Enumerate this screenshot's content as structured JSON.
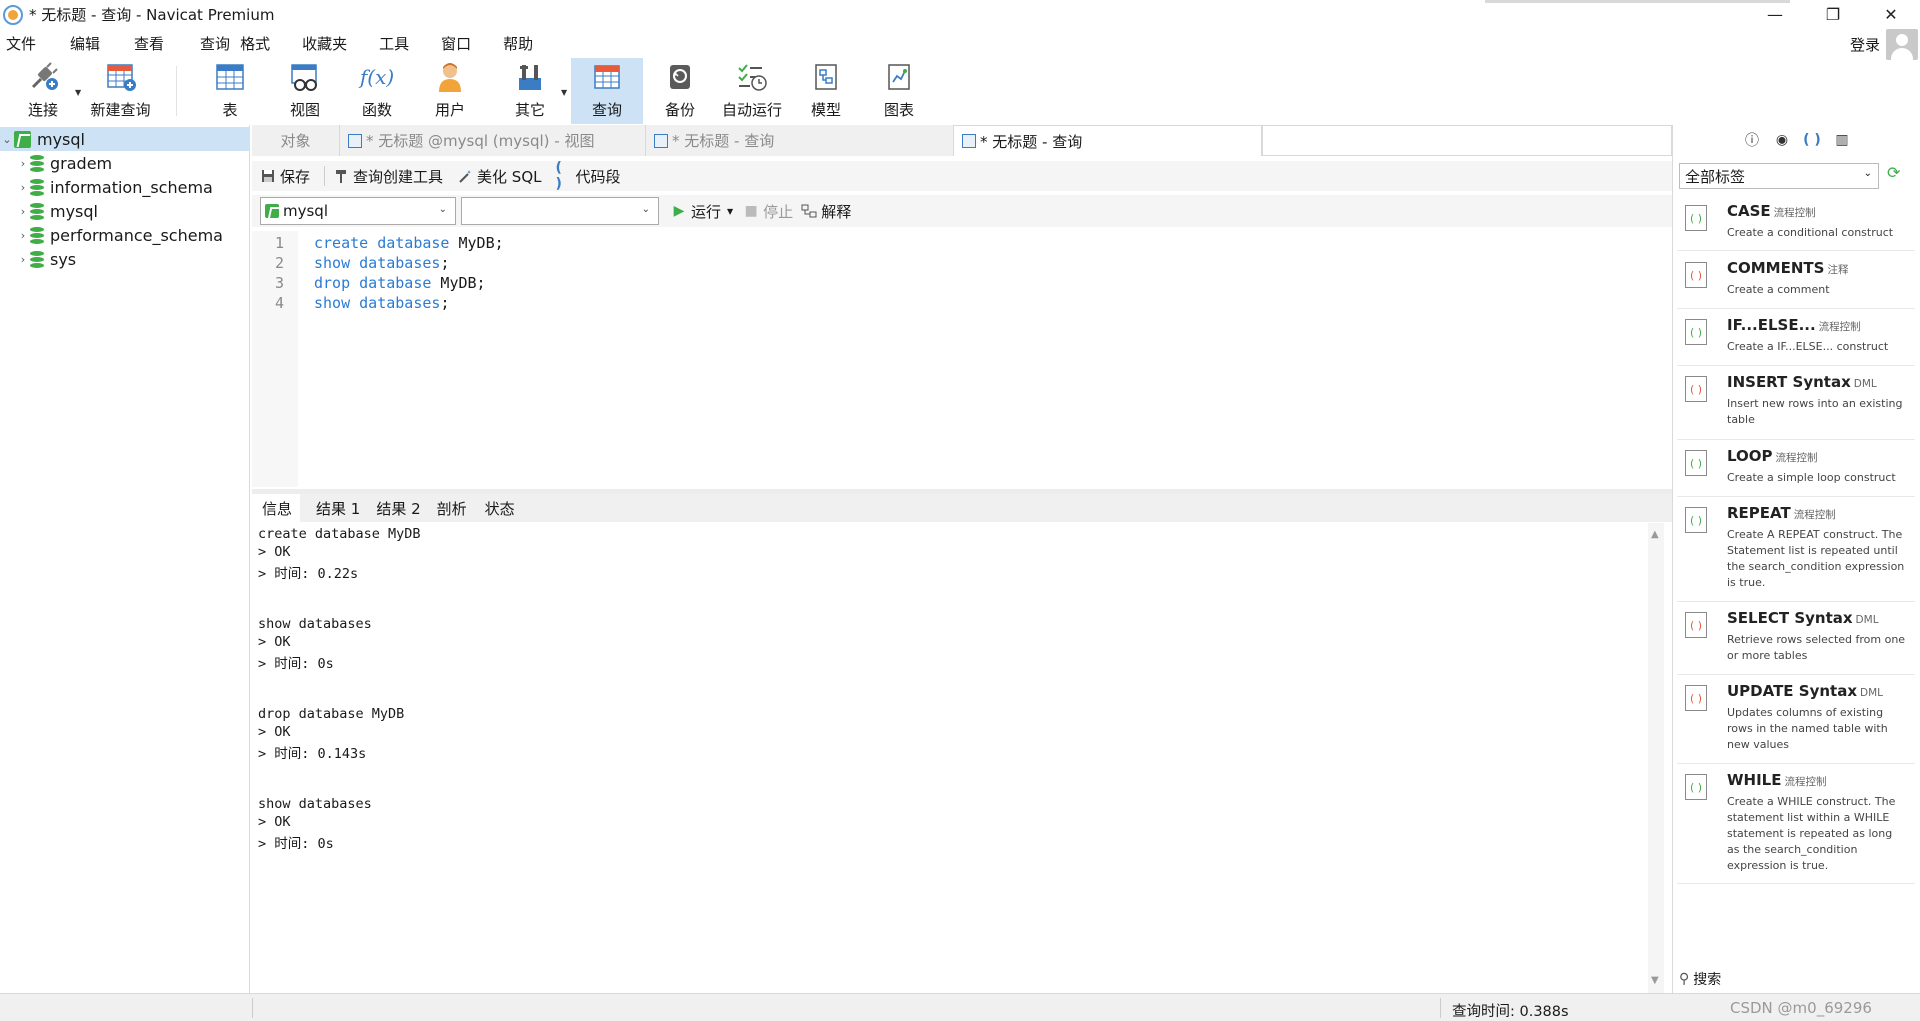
{
  "window": {
    "title": "* 无标题 - 查询 - Navicat Premium",
    "controls": [
      "—",
      "❐",
      "✕"
    ]
  },
  "menu": {
    "items": [
      "文件",
      "编辑",
      "查看",
      "查询",
      "格式",
      "收藏夹",
      "工具",
      "窗口",
      "帮助"
    ],
    "login": "登录"
  },
  "toolbar": {
    "items": [
      {
        "label": "连接",
        "icon": "connection-plug-icon"
      },
      {
        "label": "新建查询",
        "icon": "new-query-icon"
      },
      {
        "label": "表",
        "icon": "table-icon"
      },
      {
        "label": "视图",
        "icon": "view-icon"
      },
      {
        "label": "函数",
        "icon": "function-icon",
        "glyph": "f(x)"
      },
      {
        "label": "用户",
        "icon": "user-icon"
      },
      {
        "label": "其它",
        "icon": "tools-icon"
      },
      {
        "label": "查询",
        "icon": "query-icon"
      },
      {
        "label": "备份",
        "icon": "backup-icon"
      },
      {
        "label": "自动运行",
        "icon": "schedule-icon"
      },
      {
        "label": "模型",
        "icon": "model-icon"
      },
      {
        "label": "图表",
        "icon": "chart-icon"
      }
    ],
    "active": "查询"
  },
  "tree": {
    "connection": "mysql",
    "databases": [
      "gradem",
      "information_schema",
      "mysql",
      "performance_schema",
      "sys"
    ]
  },
  "tabs": [
    {
      "label": "对象"
    },
    {
      "label": "* 无标题 @mysql (mysql) - 视图"
    },
    {
      "label": "* 无标题 - 查询"
    },
    {
      "label": "* 无标题 - 查询"
    }
  ],
  "editor_toolbar": {
    "save": "保存",
    "query_builder": "查询创建工具",
    "beautify": "美化 SQL",
    "snippet": "代码段"
  },
  "selectors": {
    "connection": "mysql",
    "database": "",
    "run": "运行",
    "stop": "停止",
    "explain": "解释"
  },
  "editor": {
    "lines": [
      {
        "n": "1",
        "kw": "create database",
        "rest": " MyDB;"
      },
      {
        "n": "2",
        "kw": "show databases",
        "rest": ";"
      },
      {
        "n": "3",
        "kw": "drop database",
        "rest": " MyDB;"
      },
      {
        "n": "4",
        "kw": "show databases",
        "rest": ";"
      }
    ]
  },
  "result_tabs": [
    "信息",
    "结果 1",
    "结果 2",
    "剖析",
    "状态"
  ],
  "output": [
    "create database MyDB",
    "> OK",
    "> 时间: 0.22s",
    "",
    "",
    "show databases",
    "> OK",
    "> 时间: 0s",
    "",
    "",
    "drop database MyDB",
    "> OK",
    "> 时间: 0.143s",
    "",
    "",
    "show databases",
    "> OK",
    "> 时间: 0s"
  ],
  "right_panel": {
    "filter": "全部标签",
    "search_placeholder": "搜索",
    "snippets": [
      {
        "title": "CASE",
        "tag": "流程控制",
        "desc": "Create a conditional construct"
      },
      {
        "title": "COMMENTS",
        "tag": "注释",
        "desc": "Create a comment"
      },
      {
        "title": "IF...ELSE...",
        "tag": "流程控制",
        "desc": "Create a IF...ELSE... construct"
      },
      {
        "title": "INSERT Syntax",
        "tag": "DML",
        "desc": "Insert new rows into an existing table"
      },
      {
        "title": "LOOP",
        "tag": "流程控制",
        "desc": "Create a simple loop construct"
      },
      {
        "title": "REPEAT",
        "tag": "流程控制",
        "desc": "Create A REPEAT construct. The Statement list is repeated until the search_condition expression is true."
      },
      {
        "title": "SELECT Syntax",
        "tag": "DML",
        "desc": "Retrieve rows selected from one or more tables"
      },
      {
        "title": "UPDATE Syntax",
        "tag": "DML",
        "desc": "Updates columns of existing rows in the named table with new values"
      },
      {
        "title": "WHILE",
        "tag": "流程控制",
        "desc": "Create a WHILE construct. The statement list within a WHILE statement is repeated as long as the search_condition expression is true."
      }
    ]
  },
  "status": {
    "query_time": "查询时间: 0.388s",
    "watermark": "CSDN @m0_69296"
  }
}
